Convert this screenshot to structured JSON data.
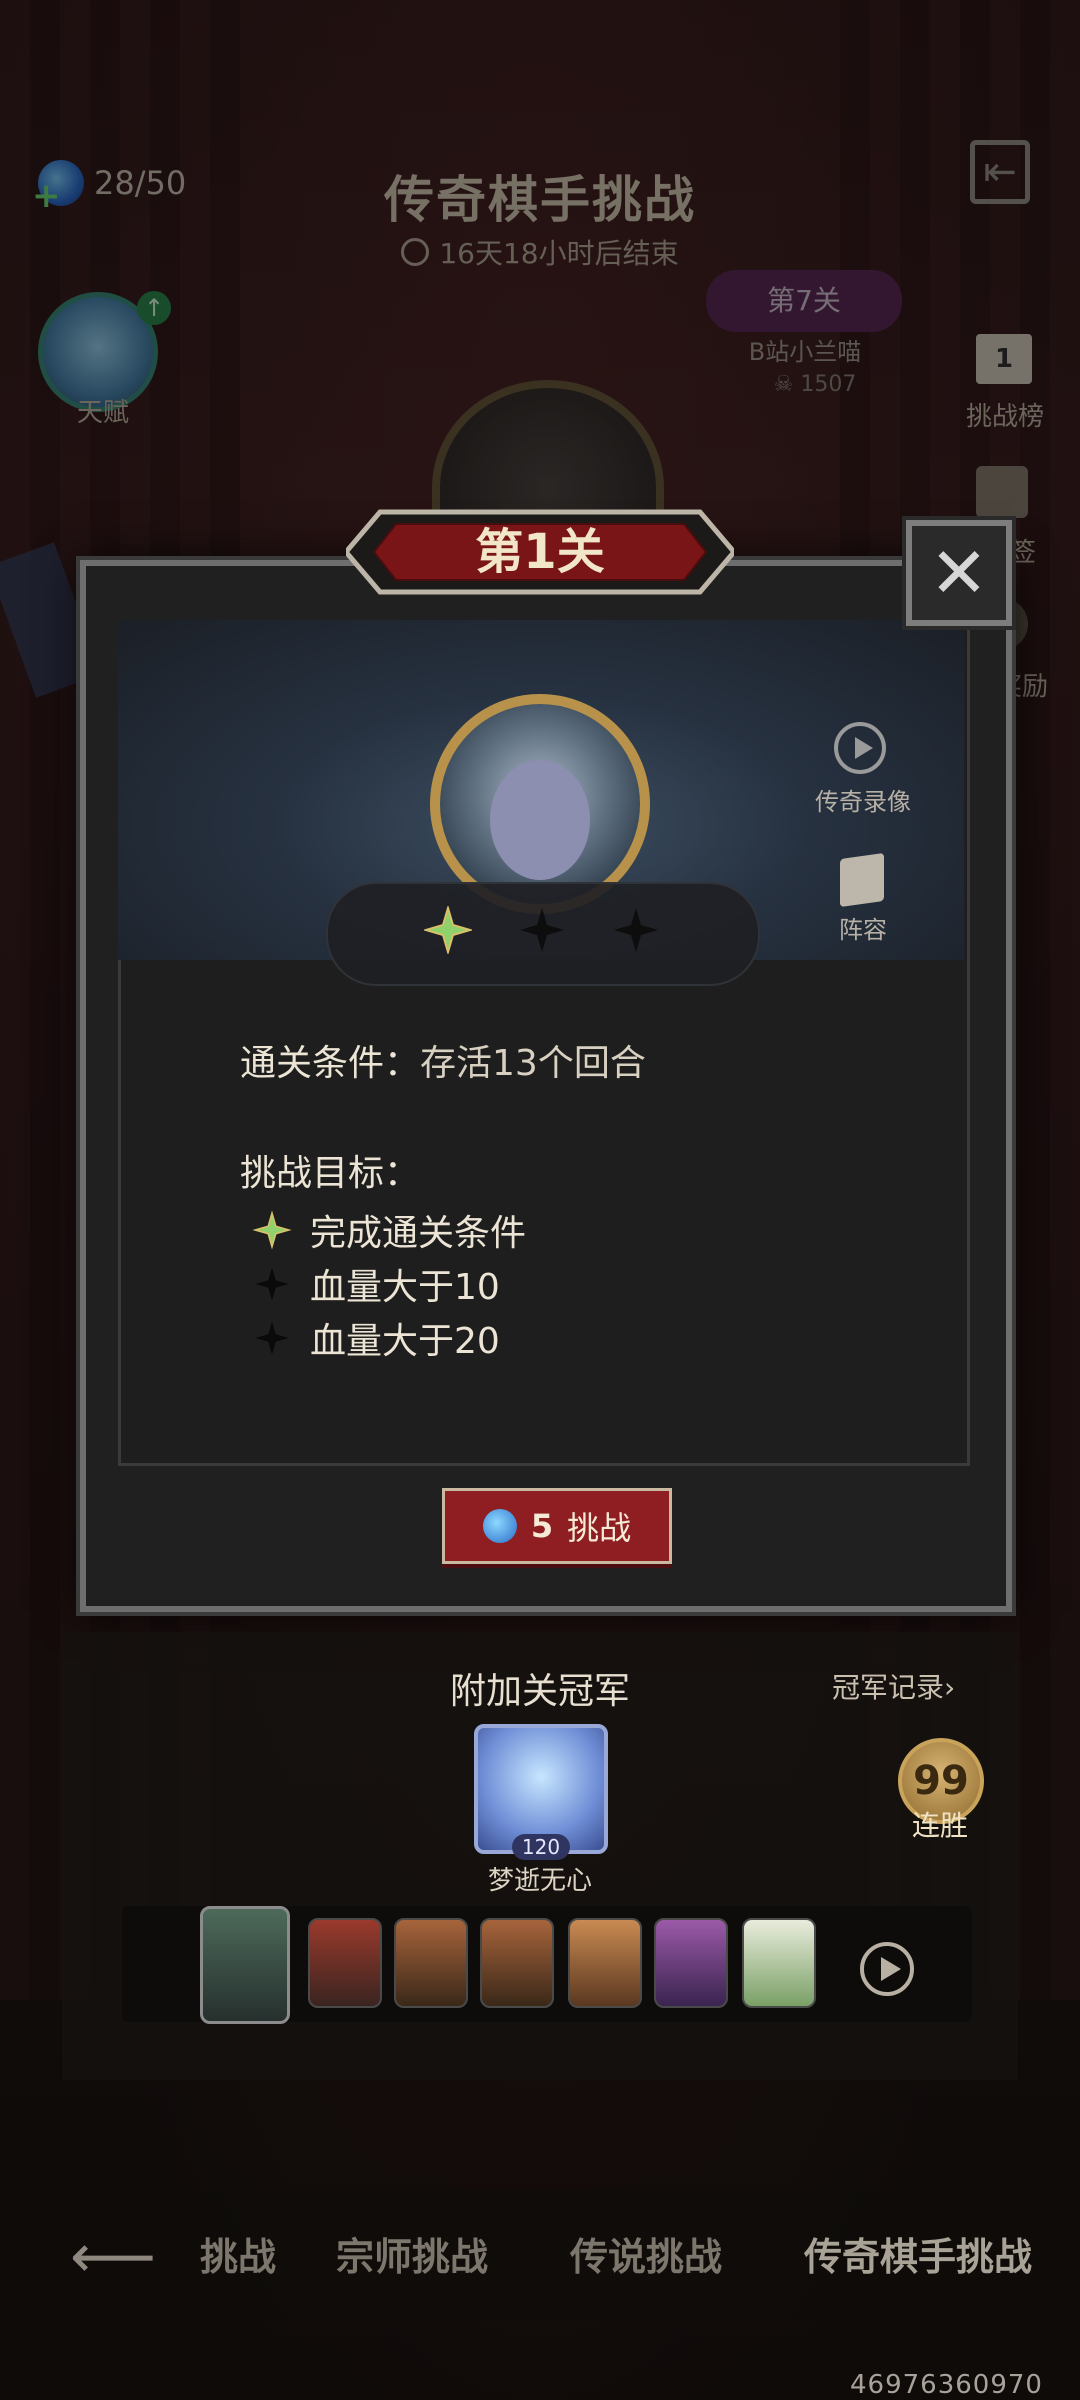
{
  "header": {
    "stamina": "28/50",
    "title": "传奇棋手挑战",
    "timer": "16天18小时后结束",
    "talent_label": "天赋",
    "rank_badge": "1",
    "rank_label": "挑战榜",
    "side_label_1": "签",
    "side_label_2": "奖励"
  },
  "stage_peek": {
    "label": "第7关",
    "user": "B站小兰喵",
    "score": "1507"
  },
  "modal": {
    "title": "第1关",
    "close_icon": "close-icon",
    "replay_label": "传奇录像",
    "lineup_label": "阵容",
    "stars": [
      {
        "earned": true
      },
      {
        "earned": false
      },
      {
        "earned": false
      }
    ],
    "condition_label": "通关条件：",
    "condition_value": "存活13个回合",
    "goals_title": "挑战目标：",
    "goals": [
      {
        "text": "完成通关条件",
        "earned": true
      },
      {
        "text": "血量大于10",
        "earned": false
      },
      {
        "text": "血量大于20",
        "earned": false
      }
    ],
    "challenge_cost": "5",
    "challenge_label": "挑战"
  },
  "bonus": {
    "title": "附加关冠军",
    "record_label": "冠军记录›",
    "champion_level": "120",
    "champion_name": "梦逝无心",
    "streak_value": "99",
    "streak_label": "连胜"
  },
  "bottom_nav": {
    "back_icon": "back-arrow-icon",
    "tabs": [
      "挑战",
      "宗师挑战",
      "传说挑战",
      "传奇棋手挑战"
    ],
    "partial_tab": "挑战"
  },
  "uid": "46976360970",
  "colors": {
    "accent_red": "#8f1e22",
    "star_earned": "#8fd16a",
    "gold_frame": "#b8924a"
  }
}
